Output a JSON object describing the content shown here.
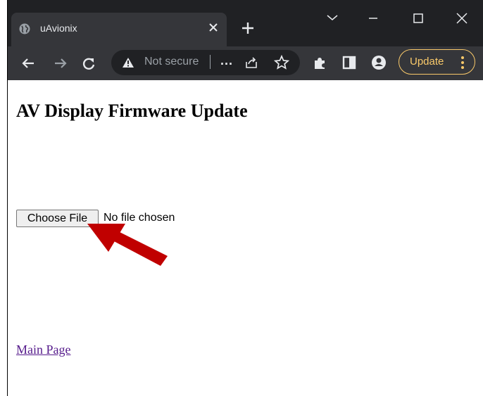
{
  "browser": {
    "tab": {
      "title": "uAvionix",
      "favicon": "globe-icon",
      "close_icon": "close-icon"
    },
    "new_tab_icon": "plus-icon",
    "window_controls": [
      "tab-search-chevron-icon",
      "minimize-icon",
      "maximize-icon",
      "close-window-icon"
    ],
    "toolbar": {
      "back_icon": "back-arrow-icon",
      "forward_icon": "forward-arrow-icon",
      "reload_icon": "reload-icon",
      "security_icon": "warning-triangle-icon",
      "security_text": "Not secure",
      "url_truncated": "...",
      "share_icon": "share-icon",
      "bookmark_icon": "star-icon",
      "extensions_icon": "puzzle-icon",
      "side_panel_icon": "side-panel-icon",
      "profile_icon": "profile-icon",
      "update_label": "Update",
      "menu_icon": "kebab-menu-icon"
    },
    "colors": {
      "titlebar": "#202124",
      "toolbar": "#35363a",
      "update_accent": "#f9c96a",
      "link_visited": "#551a8b",
      "arrow_red": "#c00000"
    }
  },
  "page": {
    "title": "AV Display Firmware Update",
    "file_input": {
      "button_label": "Choose File",
      "status": "No file chosen"
    },
    "annotation_arrow": "red-arrow-pointing-to-choose-file",
    "main_link": "Main Page"
  }
}
